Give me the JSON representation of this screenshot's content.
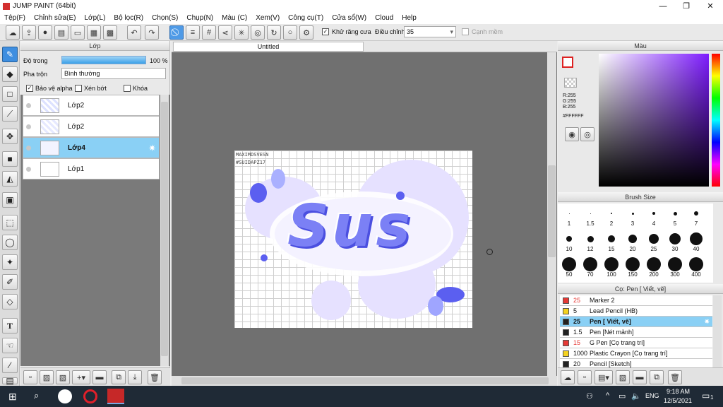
{
  "window": {
    "title": "JUMP PAINT (64bit)",
    "controls": [
      "—",
      "❐",
      "✕"
    ]
  },
  "menu": [
    "Tệp(F)",
    "Chỉnh sửa(E)",
    "Lớp(L)",
    "Bộ lọc(R)",
    "Chọn(S)",
    "Chụp(N)",
    "Màu (C)",
    "Xem(V)",
    "Công cụ(T)",
    "Cửa sổ(W)",
    "Cloud",
    "Help"
  ],
  "toolbar": {
    "antialias_label": "Khử răng cưa",
    "adjust_label": "Điều chỉnh",
    "adjust_value": "35",
    "smooth_label": "Cạnh mềm"
  },
  "layer_panel": {
    "title": "Lớp",
    "opacity_label": "Độ trong",
    "opacity_value": "100 %",
    "opacity_level": 1.0,
    "blend_label": "Pha trộn",
    "blend_value": "Bình thường",
    "protect_alpha": "Bảo vệ alpha",
    "clip": "Xén bớt",
    "lock": "Khóa",
    "layers": [
      {
        "name": "Lớp2"
      },
      {
        "name": "Lớp2"
      },
      {
        "name": "Lớp4"
      },
      {
        "name": "Lớp1"
      }
    ]
  },
  "canvas": {
    "tab": "Untitled",
    "watermark_line1": "MAXIMDSVESN",
    "watermark_line2": "#SUIDAPZ17",
    "art_text": "Sus"
  },
  "color_panel": {
    "title": "Màu",
    "r": "R:255",
    "g": "G:255",
    "b": "B:255",
    "hex": "#FFFFFF"
  },
  "brush_size_panel": {
    "title": "Brush Size",
    "sizes": [
      "1",
      "1.5",
      "2",
      "3",
      "4",
      "5",
      "7",
      "10",
      "12",
      "15",
      "20",
      "25",
      "30",
      "40",
      "50",
      "70",
      "100",
      "150",
      "200",
      "300",
      "400"
    ]
  },
  "brush_panel": {
    "title": "Cọ: Pen [ Viết, vẽ]",
    "brushes": [
      {
        "size": "25",
        "name": "Marker 2",
        "color": "#e53935"
      },
      {
        "size": "5",
        "name": "Lead Pencil (HB)",
        "color": "#f4d21f"
      },
      {
        "size": "25",
        "name": "Pen [ Viết, vẽ]",
        "color": "#222222"
      },
      {
        "size": "1.5",
        "name": "Pen [Nét mảnh]",
        "color": "#222222"
      },
      {
        "size": "15",
        "name": "G Pen [Cọ trang trí]",
        "color": "#e53935"
      },
      {
        "size": "1000",
        "name": "Plastic Crayon [Cọ trang trí]",
        "color": "#f4d21f"
      },
      {
        "size": "20",
        "name": "Pencil [Sketch]",
        "color": "#222222"
      }
    ]
  },
  "taskbar": {
    "lang": "ENG",
    "time": "9:18 AM",
    "date": "12/5/2021",
    "notif": "1"
  }
}
